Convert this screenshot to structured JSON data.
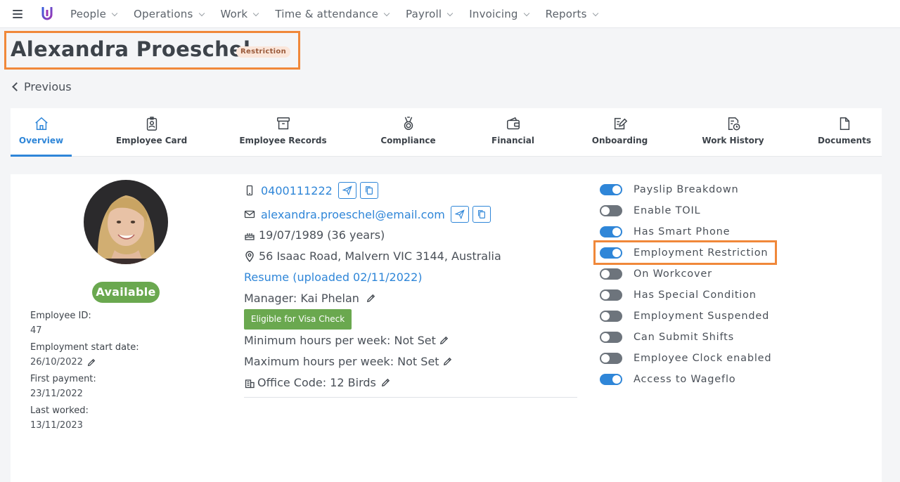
{
  "nav": {
    "items": [
      {
        "label": "People"
      },
      {
        "label": "Operations"
      },
      {
        "label": "Work"
      },
      {
        "label": "Time & attendance"
      },
      {
        "label": "Payroll"
      },
      {
        "label": "Invoicing"
      },
      {
        "label": "Reports"
      }
    ]
  },
  "header": {
    "name": "Alexandra Proeschel",
    "badge": "Restriction",
    "previous": "Previous"
  },
  "tabs": [
    {
      "label": "Overview",
      "icon": "home-icon"
    },
    {
      "label": "Employee Card",
      "icon": "id-badge-icon"
    },
    {
      "label": "Employee Records",
      "icon": "archive-icon"
    },
    {
      "label": "Compliance",
      "icon": "medal-icon"
    },
    {
      "label": "Financial",
      "icon": "wallet-icon"
    },
    {
      "label": "Onboarding",
      "icon": "edit-note-icon"
    },
    {
      "label": "Work History",
      "icon": "document-clock-icon"
    },
    {
      "label": "Documents",
      "icon": "file-icon"
    }
  ],
  "profile": {
    "status": "Available",
    "employee_id_label": "Employee ID:",
    "employee_id": "47",
    "start_label": "Employment start date:",
    "start_date": "26/10/2022",
    "first_payment_label": "First payment:",
    "first_payment": "23/11/2022",
    "last_worked_label": "Last worked:",
    "last_worked": "13/11/2023"
  },
  "contact": {
    "phone": "0400111222",
    "email": "alexandra.proeschel@email.com",
    "dob": "19/07/1989 (36 years)",
    "address": "56 Isaac Road, Malvern VIC 3144, Australia",
    "resume": "Resume (uploaded 02/11/2022)",
    "manager": "Manager: Kai Phelan",
    "visa_button": "Eligible for Visa Check",
    "min_hours": "Minimum hours per week: Not Set",
    "max_hours": "Maximum hours per week: Not Set",
    "office_code": "Office Code: 12 Birds"
  },
  "toggles": [
    {
      "label": "Payslip Breakdown",
      "on": true
    },
    {
      "label": "Enable TOIL",
      "on": false
    },
    {
      "label": "Has Smart Phone",
      "on": true
    },
    {
      "label": "Employment Restriction",
      "on": true
    },
    {
      "label": "On Workcover",
      "on": false
    },
    {
      "label": "Has Special Condition",
      "on": false
    },
    {
      "label": "Employment Suspended",
      "on": false
    },
    {
      "label": "Can Submit Shifts",
      "on": false
    },
    {
      "label": "Employee Clock enabled",
      "on": false
    },
    {
      "label": "Access to Wageflo",
      "on": true
    }
  ],
  "colors": {
    "accent": "#2f86d8",
    "success": "#6aa84f",
    "highlight": "#f0883a"
  }
}
